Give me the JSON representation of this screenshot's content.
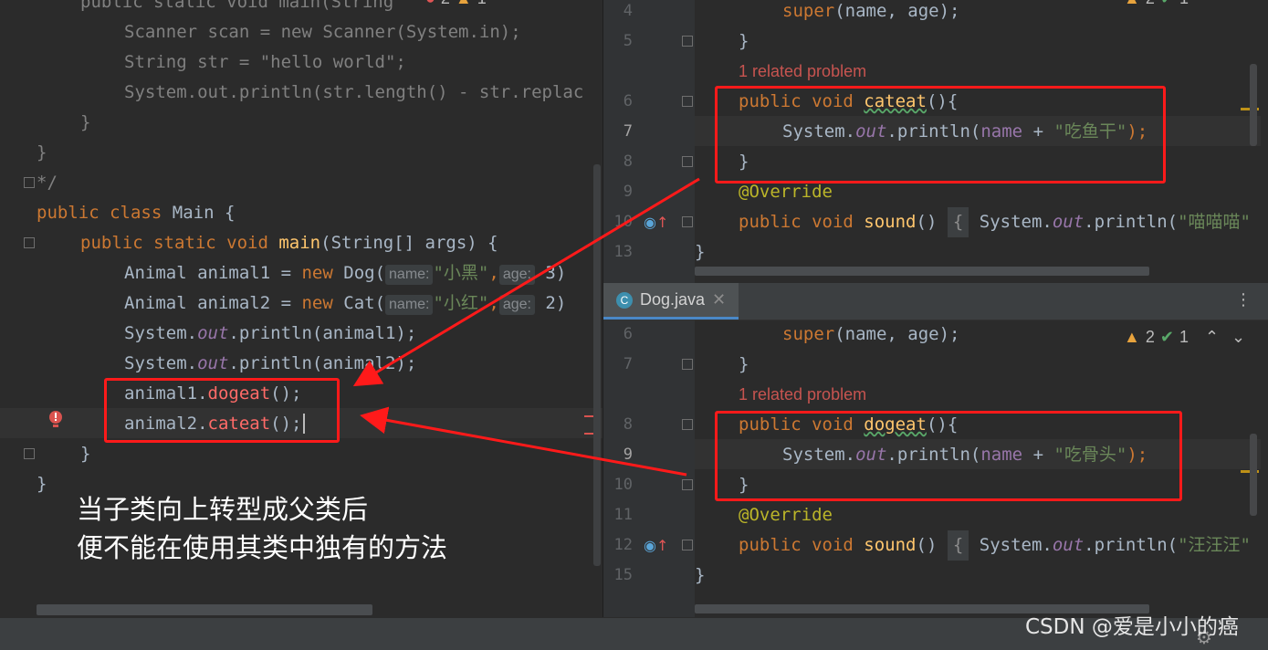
{
  "left_editor": {
    "lines": [
      {
        "segments": [
          {
            "t": "public static void main(String",
            "c": "kw"
          }
        ],
        "partial": true
      },
      {
        "segments": [
          {
            "t": "Scanner scan = new Scanner(System.in);",
            "c": "cm"
          }
        ]
      },
      {
        "segments": [
          {
            "t": "String str = \"hello world\";",
            "c": "cm"
          }
        ]
      },
      {
        "segments": [
          {
            "t": "System.out.println(str.length() - str.replac",
            "c": "cm"
          }
        ]
      },
      {
        "segments": [
          {
            "t": "}",
            "c": "cm"
          }
        ]
      },
      {
        "segments": [
          {
            "t": "}",
            "c": "cm"
          }
        ]
      },
      {
        "segments": [
          {
            "t": "*/",
            "c": "cm"
          }
        ]
      }
    ],
    "class_decl": {
      "kw1": "public",
      "kw2": "class",
      "name": "Main",
      "brace": "{"
    },
    "main_decl": {
      "kw": "public static void",
      "name": "main",
      "params": "(String[] args) {"
    },
    "animal1": {
      "type": "Animal animal1 = ",
      "new": "new",
      "cls": "Dog(",
      "hint1": "name:",
      "val1": "\"小黑\"",
      "comma": ",",
      "hint2": "age:",
      "val2": "3)"
    },
    "animal2": {
      "type": "Animal animal2 = ",
      "new": "new",
      "cls": "Cat(",
      "hint1": "name:",
      "val1": "\"小红\"",
      "comma": ",",
      "hint2": "age:",
      "val2": "2)"
    },
    "print1": {
      "pre": "System.",
      "out": "out",
      "post": ".println(animal1);"
    },
    "print2": {
      "pre": "System.",
      "out": "out",
      "post": ".println(animal2);"
    },
    "call1": {
      "obj": "animal1.",
      "m": "dogeat",
      "post": "();"
    },
    "call2": {
      "obj": "animal2.",
      "m": "cateat",
      "post": "();"
    },
    "close_method": "}",
    "close_class": "}",
    "inspection": {
      "errors": "2",
      "warnings": "1"
    }
  },
  "annotation": {
    "line1": "当子类向上转型成父类后",
    "line2": "便不能在使用其类中独有的方法"
  },
  "cat_editor": {
    "line_numbers": [
      "4",
      "5",
      "6",
      "7",
      "8",
      "9",
      "10",
      "13"
    ],
    "super_call": {
      "kw": "super",
      "post": "(name, age);"
    },
    "close1": "}",
    "related": "1 related problem",
    "method": {
      "kw": "public void",
      "name": "cateat",
      "post": "(){"
    },
    "println": {
      "pre": "System.",
      "out": "out",
      "mid": ".println(",
      "fld": "name",
      "op": " + ",
      "str": "\"吃鱼干\"",
      "end": ");"
    },
    "close2": "}",
    "override": "@Override",
    "sound": {
      "kw": "public void",
      "name": "sound",
      "post": "()",
      "fold": "{",
      "body_pre": "System.",
      "out": "out",
      "body_post": ".println(",
      "str": "\"喵喵喵\""
    },
    "close3": "}",
    "inspection": {
      "warnings": "2",
      "checks": "1"
    }
  },
  "dog_editor": {
    "tab_label": "Dog.java",
    "line_numbers": [
      "6",
      "7",
      "8",
      "9",
      "10",
      "11",
      "12",
      "15"
    ],
    "super_call": {
      "kw": "super",
      "post": "(name, age);"
    },
    "close1": "}",
    "related": "1 related problem",
    "method": {
      "kw": "public void",
      "name": "dogeat",
      "post": "(){"
    },
    "println": {
      "pre": "System.",
      "out": "out",
      "mid": ".println(",
      "fld": "name",
      "op": " + ",
      "str": "\"吃骨头\"",
      "end": ");"
    },
    "close2": "}",
    "override": "@Override",
    "sound": {
      "kw": "public void",
      "name": "sound",
      "post": "()",
      "fold": "{",
      "body_pre": "System.",
      "out": "out",
      "body_post": ".println(",
      "str": "\"汪汪汪\""
    },
    "close3": "}",
    "inspection": {
      "warnings": "2",
      "checks": "1"
    }
  },
  "watermark": "CSDN @爱是小小的癌",
  "colors": {
    "highlight_box": "#ff1a1a",
    "background": "#2b2b2b"
  }
}
